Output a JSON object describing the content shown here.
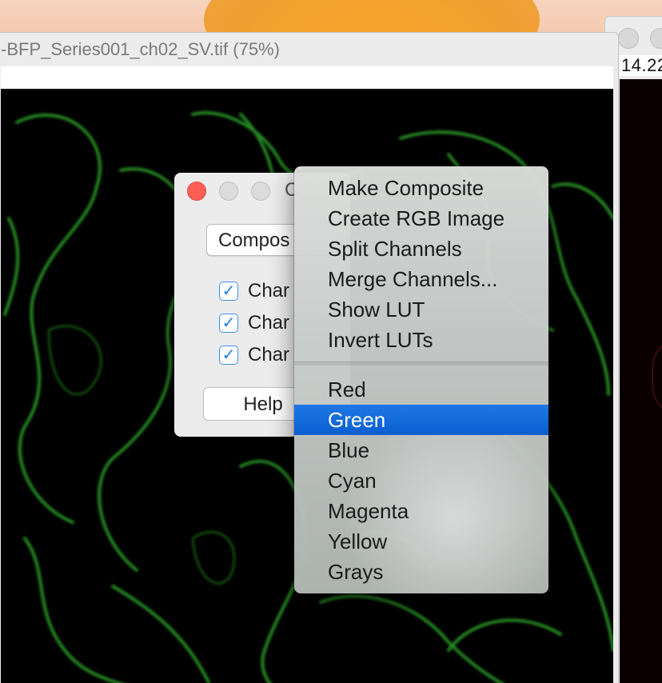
{
  "image_window": {
    "title": "-BFP_Series001_ch02_SV.tif (75%)"
  },
  "second_window": {
    "info_text": "14.22"
  },
  "channels_dialog": {
    "title": "C",
    "mode_select": {
      "value": "Compos"
    },
    "channels": [
      {
        "label": "Char",
        "checked": true
      },
      {
        "label": "Char",
        "checked": true
      },
      {
        "label": "Char",
        "checked": true
      }
    ],
    "help_button": "Help"
  },
  "popup_menu": {
    "actions": [
      "Make Composite",
      "Create RGB Image",
      "Split Channels",
      "Merge Channels...",
      "Show LUT",
      "Invert LUTs"
    ],
    "luts": [
      "Red",
      "Green",
      "Blue",
      "Cyan",
      "Magenta",
      "Yellow",
      "Grays"
    ],
    "selected": "Green"
  },
  "colors": {
    "image_signal": "#2fa82a",
    "menu_highlight": "#0b63d6",
    "close_button": "#fd5f57",
    "checkbox_accent": "#1f7bea"
  },
  "icons": {
    "checkmark": "check-icon",
    "close": "close-traffic-light-icon"
  }
}
